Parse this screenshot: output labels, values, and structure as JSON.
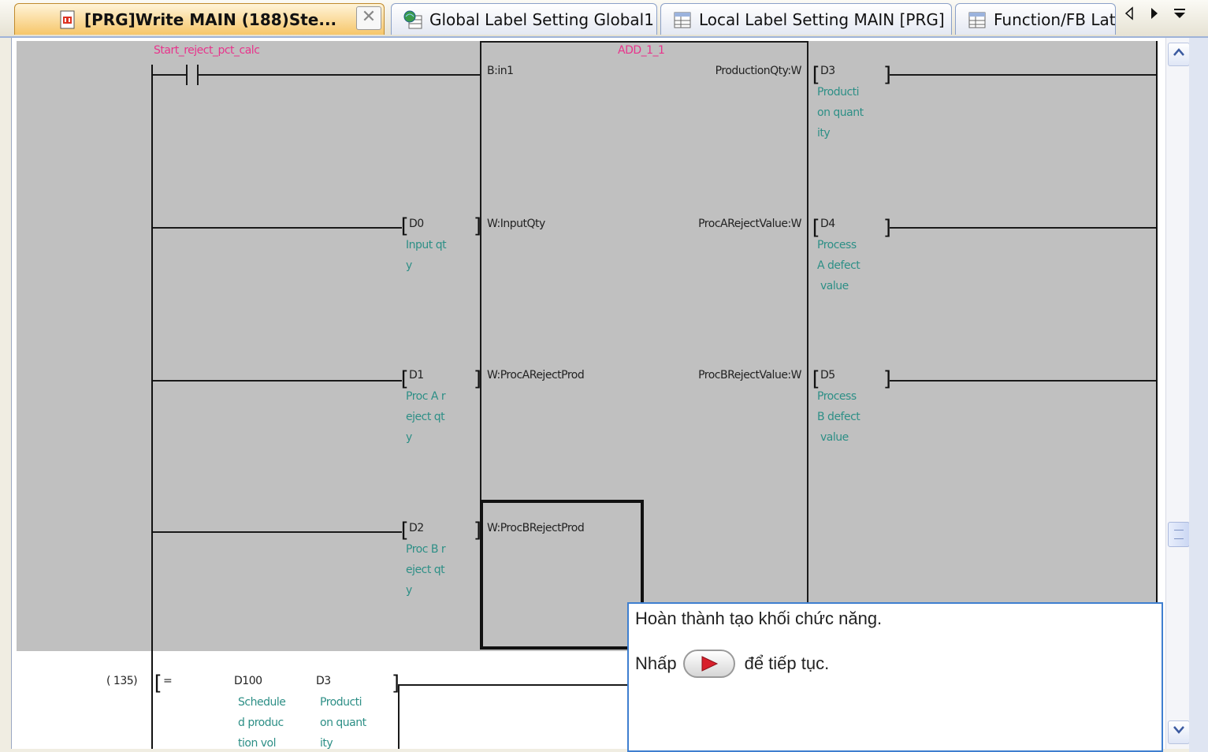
{
  "tabs": [
    {
      "label": "[PRG]Write MAIN (188)Ste...",
      "active": true
    },
    {
      "label": "Global Label Setting Global1",
      "active": false
    },
    {
      "label": "Local Label Setting MAIN [PRG]",
      "active": false
    },
    {
      "label": "Function/FB Lat",
      "active": false
    }
  ],
  "tab_close_glyph": "✕",
  "ladder": {
    "contact_label": "Start_reject_pct_calc",
    "fb_name": "ADD_1_1",
    "inputs": [
      {
        "device": "",
        "comment": [],
        "pin": "B:in1"
      },
      {
        "device": "D0",
        "comment": [
          "Input qt",
          "y"
        ],
        "pin": "W:InputQty"
      },
      {
        "device": "D1",
        "comment": [
          "Proc A r",
          "eject qt",
          "y"
        ],
        "pin": "W:ProcARejectProd"
      },
      {
        "device": "D2",
        "comment": [
          "Proc B r",
          "eject qt",
          "y"
        ],
        "pin": "W:ProcBRejectProd"
      }
    ],
    "outputs": [
      {
        "pin": "ProductionQty:W",
        "device": "D3",
        "comment": [
          "Producti",
          "on quant",
          "ity"
        ]
      },
      {
        "pin": "ProcARejectValue:W",
        "device": "D4",
        "comment": [
          "Process",
          "A defect",
          " value"
        ]
      },
      {
        "pin": "ProcBRejectValue:W",
        "device": "D5",
        "comment": [
          "Process",
          "B defect",
          " value"
        ]
      }
    ],
    "next_rung": {
      "step": "(   135)",
      "op": "=",
      "arg1_device": "D100",
      "arg1_comment": [
        "Schedule",
        "d produc",
        "tion vol"
      ],
      "arg2_device": "D3",
      "arg2_comment": [
        "Producti",
        "on quant",
        "ity"
      ]
    }
  },
  "popup": {
    "line1": "Hoàn thành tạo khối chức năng.",
    "line2_before": "Nhấp",
    "line2_after": "để tiếp tục."
  },
  "icons": {
    "program": "program-doc-icon",
    "global": "globe-table-icon",
    "local": "label-table-icon",
    "fb": "label-table-icon",
    "next": "play-arrow-icon"
  },
  "colors": {
    "ladder_bg": "#c0c0c0",
    "comment": "#2d8f86",
    "label_pink": "#e8348c",
    "active_tab": "#f6c66a",
    "popup_border": "#3f7fd0",
    "arrow_red": "#d8202c"
  }
}
